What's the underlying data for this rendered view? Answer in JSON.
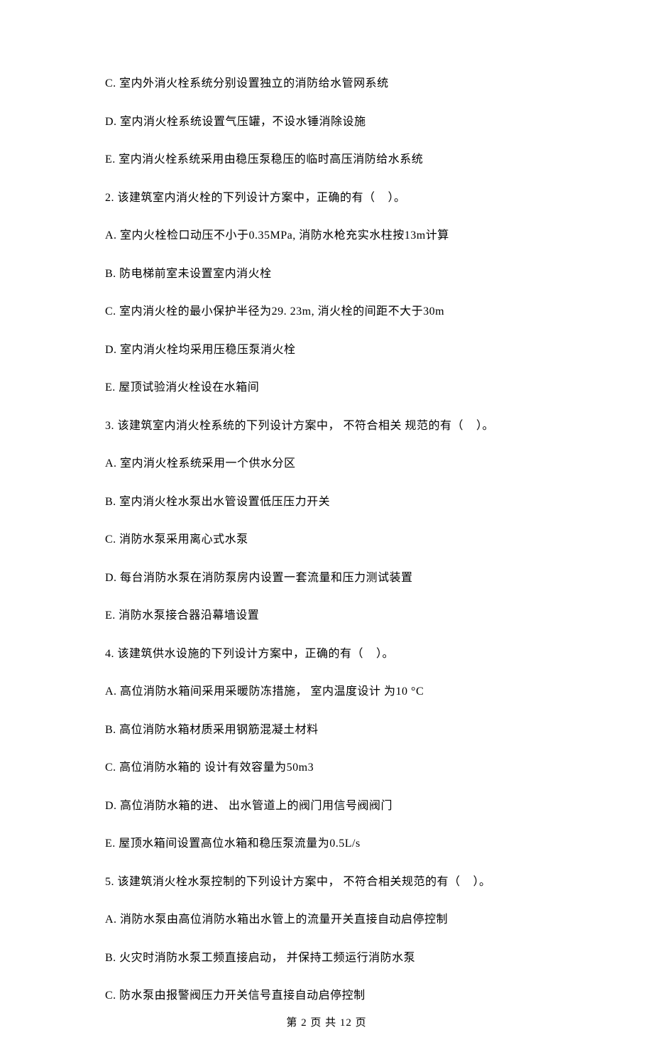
{
  "lines": [
    "C. 室内外消火栓系统分别设置独立的消防给水管网系统",
    "D. 室内消火栓系统设置气压罐，不设水锤消除设施",
    "E. 室内消火栓系统采用由稳压泵稳压的临时高压消防给水系统",
    "2. 该建筑室内消火栓的下列设计方案中，正确的有（    ）。",
    "A. 室内火栓检口动压不小于0.35MPa, 消防水枪充实水柱按13m计算",
    "B. 防电梯前室未设置室内消火栓",
    "C. 室内消火栓的最小保护半径为29. 23m, 消火栓的间距不大于30m",
    "D. 室内消火栓均采用压稳压泵消火栓",
    "E. 屋顶试验消火栓设在水箱间",
    "3. 该建筑室内消火栓系统的下列设计方案中， 不符合相关 规范的有（    ）。",
    "A. 室内消火栓系统采用一个供水分区",
    "B. 室内消火栓水泵出水管设置低压压力开关",
    "C. 消防水泵采用离心式水泵",
    "D. 每台消防水泵在消防泵房内设置一套流量和压力测试装置",
    "E. 消防水泵接合器沿幕墙设置",
    "4. 该建筑供水设施的下列设计方案中，正确的有（    ）。",
    "A. 高位消防水箱间采用采暖防冻措施， 室内温度设计 为10 °C",
    "B. 高位消防水箱材质采用钢筋混凝土材料",
    "C. 高位消防水箱的 设计有效容量为50m3",
    "D. 高位消防水箱的进、 出水管道上的阀门用信号阀阀门",
    "E. 屋顶水箱间设置高位水箱和稳压泵流量为0.5L/s",
    "5. 该建筑消火栓水泵控制的下列设计方案中， 不符合相关规范的有（    ）。",
    "A. 消防水泵由高位消防水箱出水管上的流量开关直接自动启停控制",
    "B. 火灾时消防水泵工频直接启动， 并保持工频运行消防水泵",
    "C. 防水泵由报警阀压力开关信号直接自动启停控制"
  ],
  "footer": "第 2 页 共 12 页"
}
